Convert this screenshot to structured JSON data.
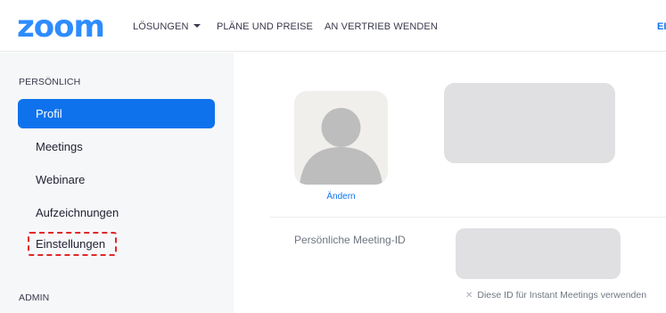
{
  "brand": {
    "logo_text": "zoom",
    "color": "#2d8cff"
  },
  "topnav": {
    "items": [
      {
        "label": "LÖSUNGEN",
        "has_dropdown": true
      },
      {
        "label": "PLÄNE UND PREISE"
      },
      {
        "label": "AN VERTRIEB WENDEN"
      }
    ],
    "cutoff_label": "EI"
  },
  "sidebar": {
    "personal_heading": "PERSÖNLICH",
    "items": [
      {
        "label": "Profil",
        "active": true
      },
      {
        "label": "Meetings"
      },
      {
        "label": "Webinare"
      },
      {
        "label": "Aufzeichnungen"
      },
      {
        "label": "Einstellungen",
        "highlighted": true
      }
    ],
    "admin_heading": "ADMIN"
  },
  "profile": {
    "change_link": "Ändern",
    "meeting_id_label": "Persönliche Meeting-ID",
    "instant_meeting_option": "Diese ID für Instant Meetings verwenden",
    "instant_meeting_icon": "x-mark-icon"
  },
  "colors": {
    "accent": "#0e72ed",
    "highlight": "#e02828",
    "sidebar_bg": "#f6f7f9"
  }
}
